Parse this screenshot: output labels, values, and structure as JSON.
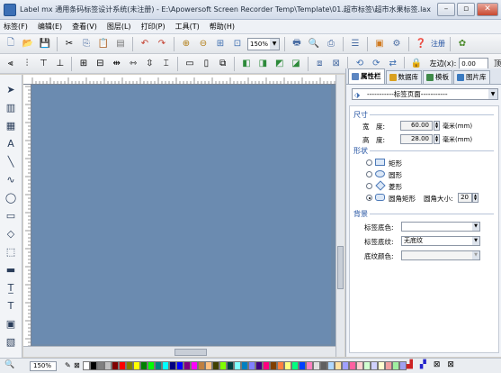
{
  "window": {
    "title": "Label mx 通用条码标签设计系统(未注册) - E:\\Apowersoft Screen Recorder Temp\\Template\\01.超市标签\\超市水果标签.lax",
    "minimize": "–",
    "maximize": "▫",
    "close": "✕"
  },
  "menu": {
    "items": [
      "标签(F)",
      "编辑(E)",
      "查看(V)",
      "图层(L)",
      "打印(P)",
      "工具(T)",
      "帮助(H)"
    ]
  },
  "toolbar": {
    "zoom_value": "150%",
    "register_label": "注册",
    "left_distance_label": "左边(x):",
    "left_distance_value": "0.00 mm",
    "extra_label": "顶"
  },
  "panel": {
    "tabs": [
      "属性栏",
      "数据库",
      "模板",
      "图片库"
    ],
    "object_select": "-----------标签页面-----------",
    "size_section": "尺寸",
    "width_label": "宽　度:",
    "width_value": "60.00",
    "height_label": "高　度:",
    "height_value": "28.00",
    "unit": "毫米(mm)",
    "shape_section": "形状",
    "shapes": [
      "矩形",
      "圆形",
      "菱形",
      "圆角矩形"
    ],
    "selected_shape": "圆角矩形",
    "corner_label": "圆角大小:",
    "corner_value": "20",
    "background_section": "背景",
    "bg_color_label": "标签底色:",
    "bg_texture_label": "标签底纹:",
    "bg_texture_value": "无底纹",
    "texture_color_label": "底纹颜色:"
  },
  "status": {
    "zoom": "150%",
    "palette": [
      "#ffffff",
      "#000000",
      "#808080",
      "#c0c0c0",
      "#800000",
      "#ff0000",
      "#808000",
      "#ffff00",
      "#008000",
      "#00ff00",
      "#008080",
      "#00ffff",
      "#000080",
      "#0000ff",
      "#800080",
      "#ff00ff",
      "#c08040",
      "#ffc080",
      "#404000",
      "#80ff00",
      "#004040",
      "#80ffff",
      "#0080c0",
      "#8080ff",
      "#400080",
      "#ff0080",
      "#804000",
      "#ff8040",
      "#ffff80",
      "#00ff80",
      "#0040ff",
      "#ff80c0",
      "#e0e0e0",
      "#606060",
      "#b0d8ff",
      "#ffe0a0",
      "#a0a0ff",
      "#ff60a0",
      "#ffd0d0",
      "#d0ffd0",
      "#d0d0ff",
      "#ffffd0",
      "#f0a0a0",
      "#a0f0a0",
      "#a0a0f0"
    ]
  },
  "colors": {
    "canvas": "#6f8aa8",
    "label_page": "#6b8bb0",
    "accent": "#1f4fa0"
  }
}
